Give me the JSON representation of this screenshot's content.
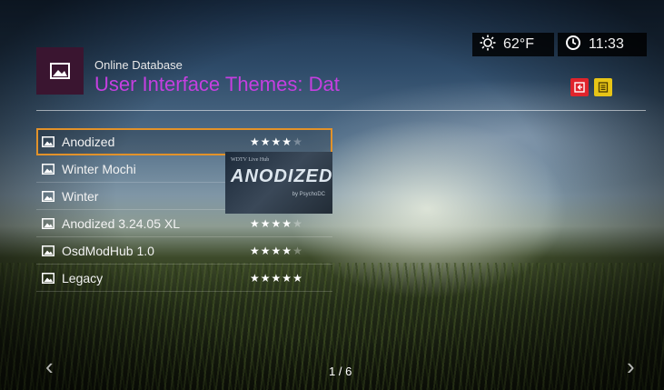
{
  "header": {
    "subtitle": "Online Database",
    "title": "User Interface Themes: Dat"
  },
  "status": {
    "temperature": "62°F",
    "time": "11:33"
  },
  "themes": [
    {
      "name": "Anodized",
      "rating": 4,
      "selected": true
    },
    {
      "name": "Winter Mochi",
      "rating": null,
      "selected": false
    },
    {
      "name": "Winter",
      "rating": null,
      "selected": false
    },
    {
      "name": "Anodized 3.24.05 XL",
      "rating": 4,
      "selected": false
    },
    {
      "name": "OsdModHub 1.0",
      "rating": 4,
      "selected": false
    },
    {
      "name": "Legacy",
      "rating": 5,
      "selected": false
    }
  ],
  "preview": {
    "line1": "WDTV Live Hub",
    "line2": "ANODIZED",
    "line3": "by PsychoDC"
  },
  "pagination": {
    "page": "1 / 6"
  },
  "icons": {
    "header": "image-icon",
    "weather": "sun-icon",
    "clock": "clock-icon",
    "red_button": "exit-icon",
    "yellow_button": "list-icon",
    "row": "image-icon"
  },
  "colors": {
    "accent": "#c53fe0",
    "selection": "#e2922a",
    "red_button": "#e0242c",
    "yellow_button": "#e7c416"
  }
}
